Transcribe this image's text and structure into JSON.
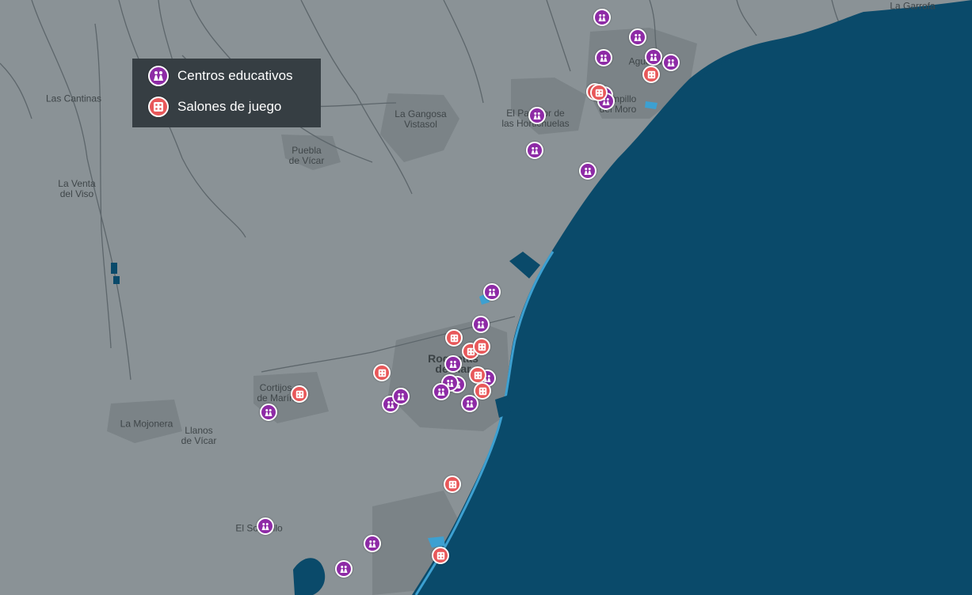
{
  "legend": {
    "items": [
      {
        "label": "Centros educativos",
        "icon": "school-children-icon",
        "color": "#8e2ba6"
      },
      {
        "label": "Salones de juego",
        "icon": "dice-icon",
        "color": "#e8585a"
      }
    ]
  },
  "colors": {
    "land": "#8a9296",
    "sea": "#0a4a6a",
    "urban": "#7a8286",
    "river": "#5d666b",
    "water": "#3da0d1"
  },
  "places": [
    {
      "name": "La Garrofa"
    },
    {
      "name": "Las Cantinas"
    },
    {
      "name": "La Gangosa\nVistasol"
    },
    {
      "name": "El Parador de\nlas Hortichuelas"
    },
    {
      "name": "Aguadulce"
    },
    {
      "name": "Campillo\ndel Moro"
    },
    {
      "name": "Puebla\nde Vícar"
    },
    {
      "name": "La Venta\ndel Viso"
    },
    {
      "name": "Roquetas\nde Mar"
    },
    {
      "name": "Cortijos\nde Marín"
    },
    {
      "name": "La Mojonera"
    },
    {
      "name": "Llanos\nde Vícar"
    },
    {
      "name": "El Solanillo"
    }
  ],
  "markers": [
    {
      "type": "edu"
    },
    {
      "type": "edu"
    },
    {
      "type": "edu"
    },
    {
      "type": "edu"
    },
    {
      "type": "edu"
    },
    {
      "type": "game"
    },
    {
      "type": "game"
    },
    {
      "type": "edu"
    },
    {
      "type": "edu"
    },
    {
      "type": "edu"
    },
    {
      "type": "edu"
    },
    {
      "type": "edu"
    },
    {
      "type": "edu"
    },
    {
      "type": "edu"
    },
    {
      "type": "game"
    },
    {
      "type": "game"
    },
    {
      "type": "game"
    },
    {
      "type": "edu"
    },
    {
      "type": "edu"
    },
    {
      "type": "game"
    },
    {
      "type": "edu"
    },
    {
      "type": "game"
    },
    {
      "type": "edu"
    },
    {
      "type": "edu"
    },
    {
      "type": "game"
    },
    {
      "type": "edu"
    },
    {
      "type": "edu"
    },
    {
      "type": "game"
    },
    {
      "type": "edu"
    },
    {
      "type": "game"
    },
    {
      "type": "edu"
    },
    {
      "type": "edu"
    },
    {
      "type": "game"
    },
    {
      "type": "game"
    },
    {
      "type": "edu"
    },
    {
      "type": "edu"
    }
  ]
}
